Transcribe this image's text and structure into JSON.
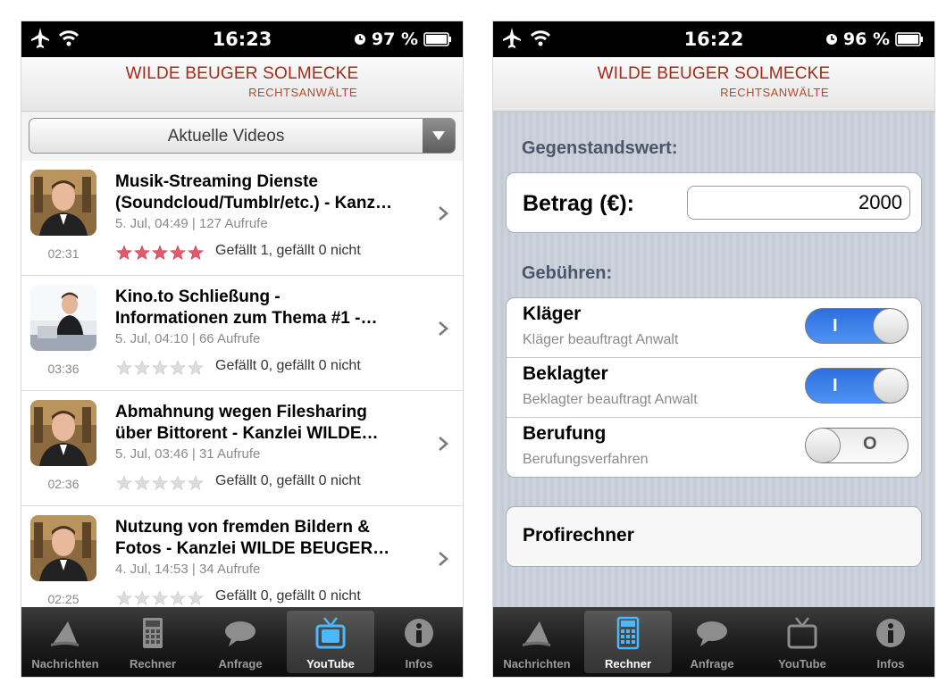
{
  "left": {
    "status": {
      "time": "16:23",
      "battery": "97 %"
    },
    "header": {
      "firm": "WILDE BEUGER SOLMECKE",
      "sub": "RECHTSANWÄLTE"
    },
    "dropdown": {
      "selected": "Aktuelle Videos"
    },
    "videos": [
      {
        "title": "Musik-Streaming Dienste\n(Soundcloud/Tumblr/etc.) - Kanz…",
        "meta": "5. Jul, 04:49 | 127 Aufrufe",
        "duration": "02:31",
        "rating": 5,
        "likes": "Gefällt 1, gefällt 0 nicht"
      },
      {
        "title": "Kino.to Schließung -\nInformationen zum Thema #1 -…",
        "meta": "5. Jul, 04:10 | 66 Aufrufe",
        "duration": "03:36",
        "rating": 0,
        "likes": "Gefällt 0, gefällt 0 nicht"
      },
      {
        "title": "Abmahnung wegen Filesharing\nüber Bittorent - Kanzlei WILDE…",
        "meta": "5. Jul, 03:46 | 31 Aufrufe",
        "duration": "02:36",
        "rating": 0,
        "likes": "Gefällt 0, gefällt 0 nicht"
      },
      {
        "title": "Nutzung von fremden Bildern &\nFotos - Kanzlei WILDE BEUGER…",
        "meta": "4. Jul, 14:53 | 34 Aufrufe",
        "duration": "02:25",
        "rating": 0,
        "likes": "Gefällt 0, gefällt 0 nicht"
      }
    ],
    "tabs": [
      {
        "label": "Nachrichten",
        "icon": "megaphone-icon"
      },
      {
        "label": "Rechner",
        "icon": "calculator-icon"
      },
      {
        "label": "Anfrage",
        "icon": "speech-bubble-icon"
      },
      {
        "label": "YouTube",
        "icon": "tv-icon"
      },
      {
        "label": "Infos",
        "icon": "info-icon"
      }
    ],
    "active_tab": "YouTube"
  },
  "right": {
    "status": {
      "time": "16:22",
      "battery": "96 %"
    },
    "header": {
      "firm": "WILDE BEUGER SOLMECKE",
      "sub": "RECHTSANWÄLTE"
    },
    "gegenstandswert_label": "Gegenstandswert:",
    "betrag": {
      "label": "Betrag (€):",
      "value": "2000"
    },
    "gebuehren_label": "Gebühren:",
    "fees": [
      {
        "title": "Kläger",
        "sub": "Kläger beauftragt Anwalt",
        "on": true
      },
      {
        "title": "Beklagter",
        "sub": "Beklagter beauftragt Anwalt",
        "on": true
      },
      {
        "title": "Berufung",
        "sub": "Berufungsverfahren",
        "on": false
      }
    ],
    "toggle_on_mark": "I",
    "toggle_off_mark": "O",
    "profi_label": "Profirechner",
    "tabs": [
      {
        "label": "Nachrichten",
        "icon": "megaphone-icon"
      },
      {
        "label": "Rechner",
        "icon": "calculator-icon"
      },
      {
        "label": "Anfrage",
        "icon": "speech-bubble-icon"
      },
      {
        "label": "YouTube",
        "icon": "tv-icon"
      },
      {
        "label": "Infos",
        "icon": "info-icon"
      }
    ],
    "active_tab": "Rechner"
  },
  "colors": {
    "firm_red": "#a52a1a",
    "toggle_blue": "#2d6fe0",
    "star_red": "#e35a6a",
    "tab_active_blue": "#4ab8ff"
  }
}
